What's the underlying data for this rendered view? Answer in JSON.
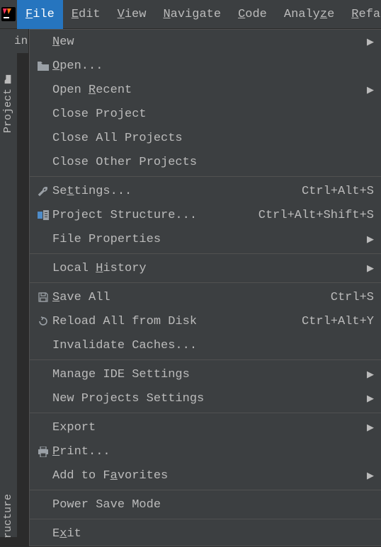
{
  "menubar": {
    "items": [
      {
        "label": "File",
        "underline_index": 0
      },
      {
        "label": "Edit",
        "underline_index": 0
      },
      {
        "label": "View",
        "underline_index": 0
      },
      {
        "label": "Navigate",
        "underline_index": 0
      },
      {
        "label": "Code",
        "underline_index": 0
      },
      {
        "label": "Analyze",
        "underline_index": 5
      },
      {
        "label": "Refa",
        "underline_index": 0
      }
    ]
  },
  "tab": {
    "label": "in"
  },
  "sidebar": {
    "project": "Project",
    "structure": "ructure"
  },
  "file_menu": {
    "items": [
      {
        "label": "New",
        "underline": "N",
        "rest": "ew",
        "arrow": true
      },
      {
        "label": "Open...",
        "underline": "O",
        "rest": "pen...",
        "icon": "folder"
      },
      {
        "label": "Open Recent",
        "pre": "Open ",
        "underline": "R",
        "rest": "ecent",
        "arrow": true
      },
      {
        "label": "Close Project",
        "plain": "Close Project"
      },
      {
        "label": "Close All Projects",
        "plain": "Close All Projects"
      },
      {
        "label": "Close Other Projects",
        "plain": "Close Other Projects"
      },
      {
        "separator": true
      },
      {
        "label": "Settings...",
        "pre": "Se",
        "underline": "t",
        "rest": "tings...",
        "icon": "wrench",
        "shortcut": "Ctrl+Alt+S"
      },
      {
        "label": "Project Structure...",
        "plain": "Project Structure...",
        "icon": "proj-struct",
        "shortcut": "Ctrl+Alt+Shift+S"
      },
      {
        "label": "File Properties",
        "plain": "File Properties",
        "arrow": true
      },
      {
        "separator": true
      },
      {
        "label": "Local History",
        "pre": "Local ",
        "underline": "H",
        "rest": "istory",
        "arrow": true
      },
      {
        "separator": true
      },
      {
        "label": "Save All",
        "underline": "S",
        "rest": "ave All",
        "icon": "save",
        "shortcut": "Ctrl+S"
      },
      {
        "label": "Reload All from Disk",
        "plain": "Reload All from Disk",
        "icon": "reload",
        "shortcut": "Ctrl+Alt+Y"
      },
      {
        "label": "Invalidate Caches...",
        "plain": "Invalidate Caches..."
      },
      {
        "separator": true
      },
      {
        "label": "Manage IDE Settings",
        "plain": "Manage IDE Settings",
        "arrow": true
      },
      {
        "label": "New Projects Settings",
        "plain": "New Projects Settings",
        "arrow": true
      },
      {
        "separator": true
      },
      {
        "label": "Export",
        "plain": "Export",
        "arrow": true
      },
      {
        "label": "Print...",
        "underline": "P",
        "rest": "rint...",
        "icon": "print"
      },
      {
        "label": "Add to Favorites",
        "pre": "Add to F",
        "underline": "a",
        "rest": "vorites",
        "arrow": true
      },
      {
        "separator": true
      },
      {
        "label": "Power Save Mode",
        "plain": "Power Save Mode"
      },
      {
        "separator": true
      },
      {
        "label": "Exit",
        "pre": "E",
        "underline": "x",
        "rest": "it"
      }
    ]
  }
}
